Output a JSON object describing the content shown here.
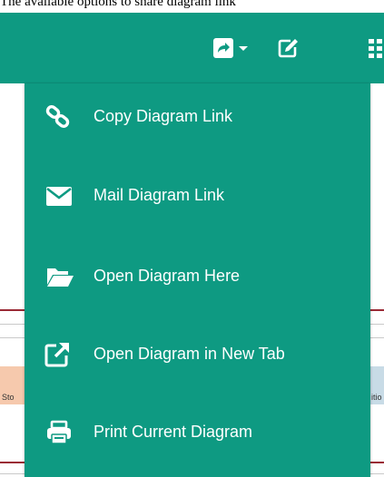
{
  "caption": "The available options to share diagram link",
  "toolbar": {
    "share_icon": "share-square-icon",
    "dropdown_icon": "caret-down-icon",
    "edit_icon": "edit-square-icon",
    "grid_icon": "grid-icon"
  },
  "colors": {
    "accent": "#0e9a82",
    "text": "#ffffff"
  },
  "share_menu": {
    "items": [
      {
        "label": "Copy Diagram Link",
        "icon": "link-icon"
      },
      {
        "label": "Mail Diagram Link",
        "icon": "envelope-icon"
      },
      {
        "label": "Open Diagram Here",
        "icon": "folder-open-icon"
      },
      {
        "label": "Open Diagram in New Tab",
        "icon": "external-link-icon"
      },
      {
        "label": "Print Current Diagram",
        "icon": "print-icon"
      }
    ]
  },
  "background": {
    "left_label": "Sto",
    "right_label": "itio"
  }
}
